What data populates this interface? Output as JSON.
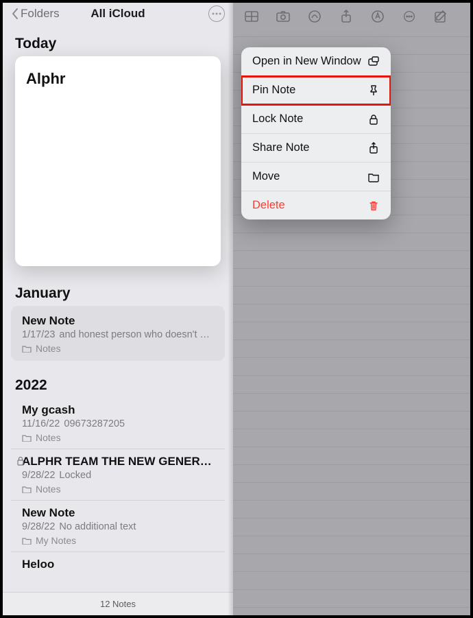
{
  "header": {
    "back_label": "Folders",
    "title": "All iCloud"
  },
  "sections": {
    "today_label": "Today",
    "january_label": "January",
    "year_label": "2022"
  },
  "preview": {
    "title": "Alphr"
  },
  "january_note": {
    "title": "New Note",
    "date": "1/17/23",
    "snippet": "and honest person who doesn't b…",
    "folder": "Notes"
  },
  "notes_2022": [
    {
      "title": "My gcash",
      "date": "11/16/22",
      "snippet": "09673287205",
      "folder": "Notes",
      "locked": false
    },
    {
      "title": "ALPHR TEAM THE NEW GENERATIO…",
      "date": "9/28/22",
      "snippet": "Locked",
      "folder": "Notes",
      "locked": true
    },
    {
      "title": "New Note",
      "date": "9/28/22",
      "snippet": "No additional text",
      "folder": "My Notes",
      "locked": false
    },
    {
      "title": "Heloo",
      "date": "",
      "snippet": "",
      "folder": "",
      "locked": false
    }
  ],
  "footer": {
    "count_text": "12 Notes"
  },
  "context_menu": {
    "open": "Open in New Window",
    "pin": "Pin Note",
    "lock": "Lock Note",
    "share": "Share Note",
    "move": "Move",
    "delete": "Delete"
  },
  "toolbar_icons": [
    "table",
    "camera",
    "markup",
    "share",
    "annotate",
    "more",
    "compose"
  ]
}
